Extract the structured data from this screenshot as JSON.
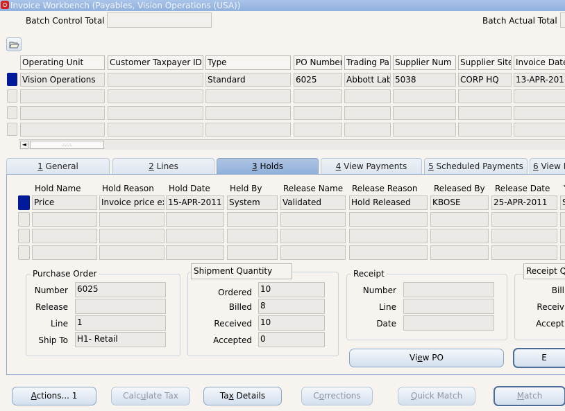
{
  "window": {
    "title": "Invoice Workbench (Payables, Vision Operations (USA))"
  },
  "batch": {
    "control_total_label": "Batch Control Total",
    "control_total_value": "",
    "actual_total_label": "Batch Actual Total",
    "actual_total_value": ""
  },
  "invoice_grid": {
    "headers": [
      "Operating Unit",
      "Customer Taxpayer ID",
      "Type",
      "PO Number",
      "Trading Pa",
      "Supplier Num",
      "Supplier Site",
      "Invoice Date"
    ],
    "rows": [
      [
        "Vision Operations",
        "",
        "Standard",
        "6025",
        "Abbott Lab",
        "5038",
        "CORP HQ",
        "13-APR-201"
      ],
      [
        "",
        "",
        "",
        "",
        "",
        "",
        "",
        ""
      ],
      [
        "",
        "",
        "",
        "",
        "",
        "",
        "",
        ""
      ],
      [
        "",
        "",
        "",
        "",
        "",
        "",
        "",
        ""
      ]
    ],
    "scroll_thumb": ".:.:.:.",
    "scroll_arrow": "◄"
  },
  "tabs": [
    {
      "key": "1",
      "rest": " General"
    },
    {
      "key": "2",
      "rest": " Lines"
    },
    {
      "key": "3",
      "rest": " Holds"
    },
    {
      "key": "4",
      "rest": " View Payments"
    },
    {
      "key": "5",
      "rest": " Scheduled Payments"
    },
    {
      "key": "6",
      "rest": " View I"
    }
  ],
  "active_tab": "3 Holds",
  "holds": {
    "headers": [
      "Hold Name",
      "Hold Reason",
      "Hold Date",
      "Held By",
      "Release Name",
      "Release Reason",
      "Released By",
      "Release Date",
      "Y"
    ],
    "rows": [
      [
        "Price",
        "Invoice price exc",
        "15-APR-2011",
        "System",
        "Validated",
        "Hold Released",
        "KBOSE",
        "25-APR-2011",
        "S"
      ],
      [
        "",
        "",
        "",
        "",
        "",
        "",
        "",
        "",
        ""
      ],
      [
        "",
        "",
        "",
        "",
        "",
        "",
        "",
        "",
        ""
      ],
      [
        "",
        "",
        "",
        "",
        "",
        "",
        "",
        "",
        ""
      ]
    ]
  },
  "purchase_order": {
    "title": "Purchase Order",
    "number_label": "Number",
    "number": "6025",
    "release_label": "Release",
    "release": "",
    "line_label": "Line",
    "line": "1",
    "ship_to_label": "Ship To",
    "ship_to": "H1- Retail"
  },
  "shipment_quantity": {
    "title": "Shipment Quantity",
    "ordered_label": "Ordered",
    "ordered": "10",
    "billed_label": "Billed",
    "billed": "8",
    "received_label": "Received",
    "received": "10",
    "accepted_label": "Accepted",
    "accepted": "0"
  },
  "receipt": {
    "title": "Receipt",
    "number_label": "Number",
    "number": "",
    "line_label": "Line",
    "line": "",
    "date_label": "Date",
    "date": ""
  },
  "receipt_quantity": {
    "title": "Receipt Q",
    "billed_label": "Bill",
    "received_label": "Receiv",
    "accepted_label": "Accept"
  },
  "buttons": {
    "view_po_pre": "Vi",
    "view_po_key": "e",
    "view_po_post": "w PO",
    "cut_button": "E",
    "actions_pre": "",
    "actions_key": "A",
    "actions_post": "ctions... 1",
    "calc_tax_pre": "Calc",
    "calc_tax_key": "u",
    "calc_tax_post": "late Tax",
    "tax_details_pre": "Ta",
    "tax_details_key": "x",
    "tax_details_post": " Details",
    "corrections_pre": "C",
    "corrections_key": "o",
    "corrections_post": "rrections",
    "quick_match_pre": "",
    "quick_match_key": "Q",
    "quick_match_post": "uick Match",
    "match_pre": "",
    "match_key": "M",
    "match_post": "atch"
  },
  "colors": {
    "selected_row": "#001a9a",
    "active_tab": "#9ab6de",
    "titlebar": "#9ab6de"
  }
}
